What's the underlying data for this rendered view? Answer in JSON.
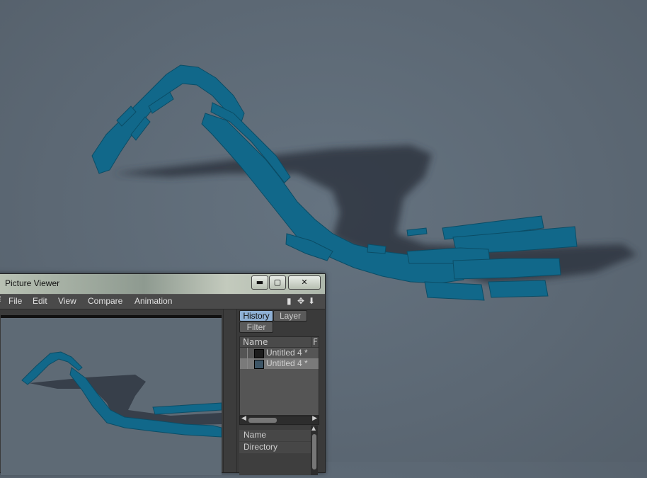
{
  "window": {
    "title": "Picture Viewer",
    "controls": {
      "minimize": "▬",
      "maximize": "▢",
      "close": "✕"
    }
  },
  "menu": {
    "items": [
      {
        "label": "File"
      },
      {
        "label": "Edit"
      },
      {
        "label": "View"
      },
      {
        "label": "Compare"
      },
      {
        "label": "Animation"
      }
    ]
  },
  "side_panel": {
    "tabs": {
      "history": "History",
      "layer": "Layer",
      "filter": "Filter"
    },
    "history": {
      "columns": {
        "name": "Name",
        "f": "F"
      },
      "rows": [
        {
          "label": "Untitled 4 *",
          "selected": false
        },
        {
          "label": "Untitled 4 *",
          "selected": true
        }
      ]
    },
    "info": {
      "name_label": "Name",
      "directory_label": "Directory"
    }
  },
  "colors": {
    "accent_object": "#11688a",
    "viewport_bg": "#5f6b77",
    "tab_active": "#8fb1d6"
  },
  "icons": {
    "toolbar": [
      "panel-toggle-icon",
      "move-icon",
      "download-arrow-icon"
    ]
  }
}
